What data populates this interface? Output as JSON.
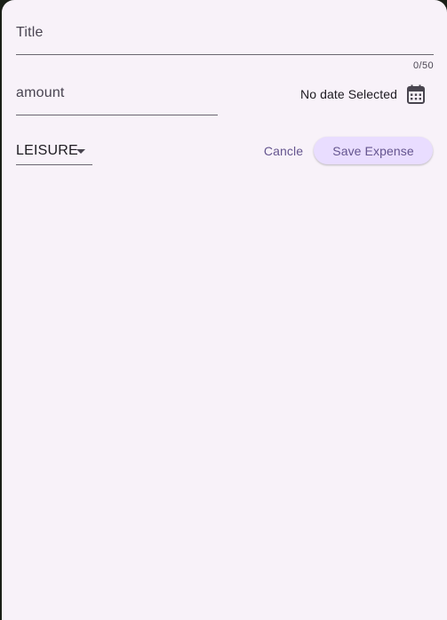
{
  "form": {
    "title_label": "Title",
    "title_counter": "0/50",
    "amount_label": "amount",
    "date_text": "No date Selected",
    "category_value": "LEISURE"
  },
  "actions": {
    "cancel_label": "Cancle",
    "save_label": "Save Expense"
  },
  "icons": {
    "calendar": "calendar-icon",
    "dropdown": "dropdown-arrow-icon"
  },
  "colors": {
    "sheet_background": "#f8f2f9",
    "accent": "#65558f",
    "save_button_background": "#e9ddff",
    "underline": "#6a6670"
  }
}
